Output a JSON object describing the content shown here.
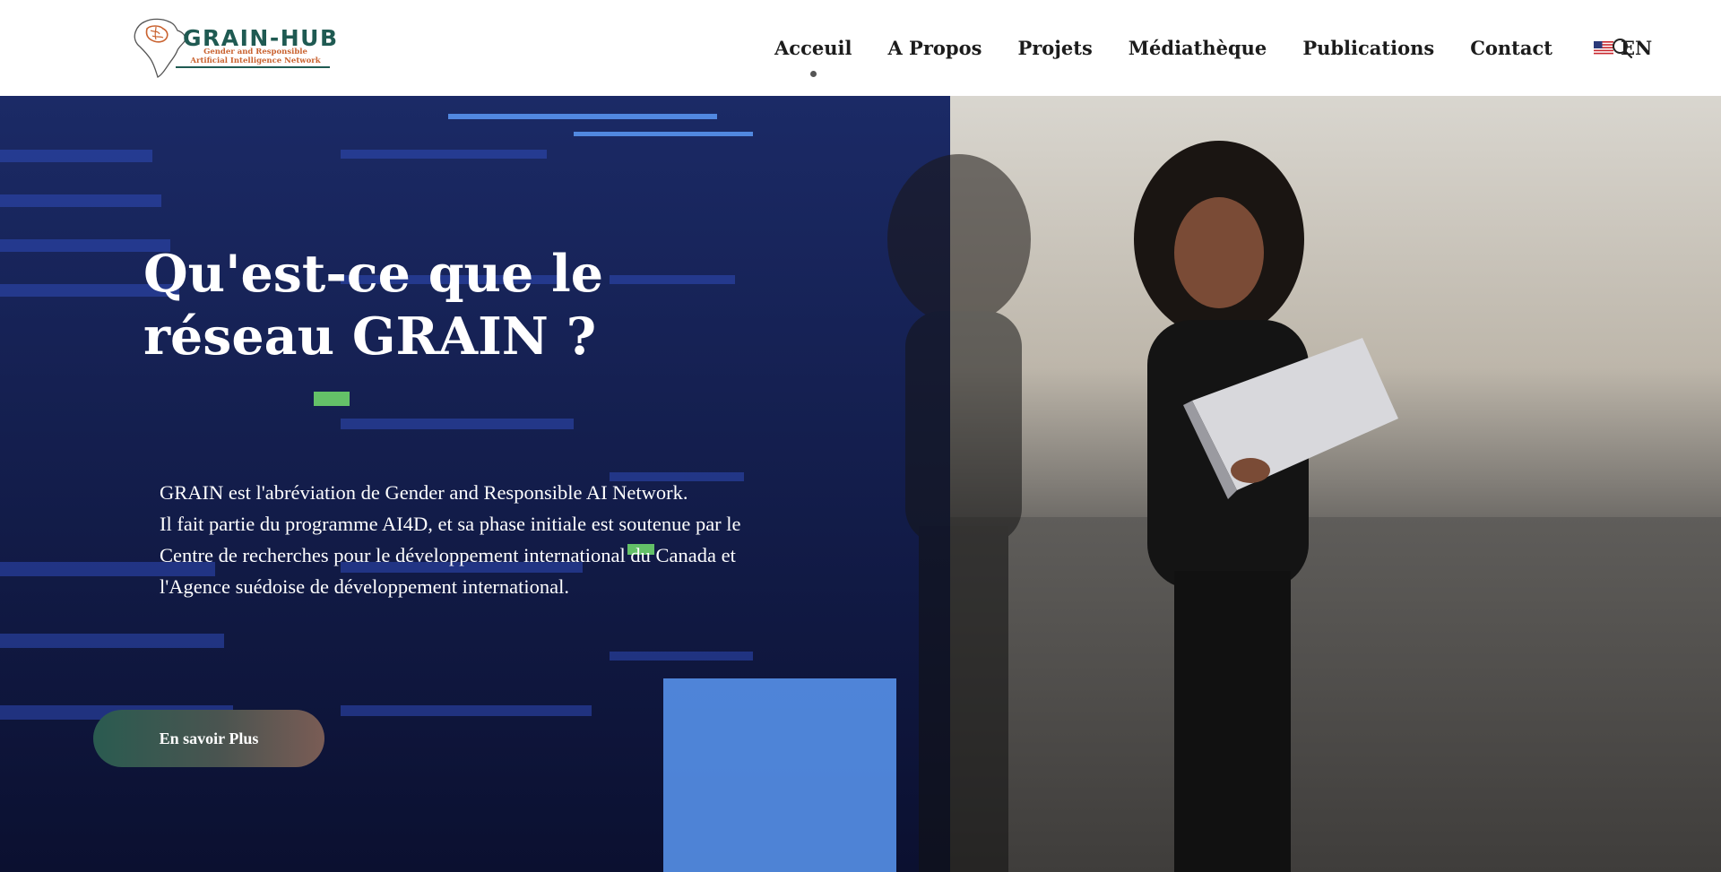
{
  "brand": {
    "name": "GRAIN-HUB",
    "tagline": "Gender and Responsible Artificial Intelligence Network"
  },
  "nav": {
    "items": [
      {
        "label": "Acceuil",
        "active": true
      },
      {
        "label": "A Propos",
        "active": false
      },
      {
        "label": "Projets",
        "active": false
      },
      {
        "label": "Médiathèque",
        "active": false
      },
      {
        "label": "Publications",
        "active": false
      },
      {
        "label": "Contact",
        "active": false
      }
    ],
    "language": {
      "label": "EN",
      "icon": "us-flag-icon"
    },
    "search_icon": "search-icon"
  },
  "hero": {
    "title": "Qu'est-ce que le réseau GRAIN ?",
    "paragraph": [
      "GRAIN est l'abréviation de Gender and Responsible AI Network.",
      "Il fait partie du programme AI4D, et sa phase initiale est soutenue par le Centre de recherches pour le développement international du Canada et l'Agence suédoise de développement international."
    ],
    "cta_label": "En savoir Plus"
  },
  "colors": {
    "brand_green": "#1f5a52",
    "brand_orange": "#c9622f",
    "nav_text": "#1c1c1c",
    "cta_start": "#2a5b50",
    "cta_end": "#7a5c55"
  }
}
